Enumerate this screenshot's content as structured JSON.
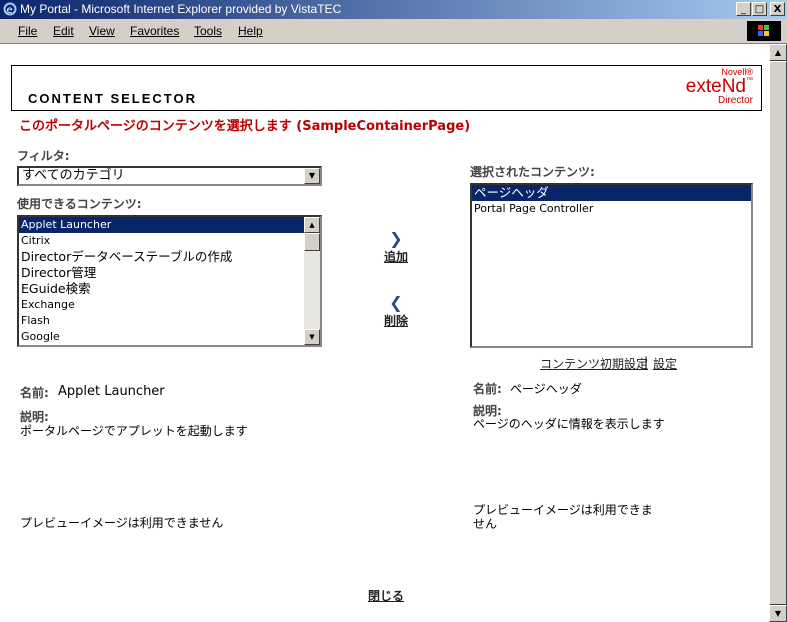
{
  "window": {
    "title": "My Portal - Microsoft Internet Explorer provided by VistaTEC",
    "minimize": "_",
    "maximize": "□",
    "close": "X"
  },
  "menu": [
    "File",
    "Edit",
    "View",
    "Favorites",
    "Tools",
    "Help"
  ],
  "header": {
    "title": "CONTENT SELECTOR",
    "brand_small": "Novell®",
    "brand_main": "exteNd",
    "brand_tm": "™",
    "brand_sub": "Director"
  },
  "page_heading": "このポータルページのコンテンツを選択します (SampleContainerPage)",
  "filter": {
    "label": "フィルタ:",
    "selected": "すべてのカテゴリ"
  },
  "available": {
    "label": "使用できるコンテンツ:",
    "items": [
      "Applet Launcher",
      "Citrix",
      "Directorデータベーステーブルの作成",
      "Director管理",
      "EGuide検索",
      "Exchange",
      "Flash",
      "Google"
    ],
    "selected_index": 0
  },
  "selected_content": {
    "label": "選択されたコンテンツ:",
    "items": [
      "ページヘッダ",
      "Portal Page Controller"
    ],
    "selected_index": 0
  },
  "actions": {
    "add": "追加",
    "remove": "削除"
  },
  "links": {
    "initial_settings": "コンテンツ初期設定",
    "separator": "|",
    "settings": "設定"
  },
  "left_detail": {
    "name_label": "名前:",
    "name_value": "Applet Launcher",
    "desc_label": "説明:",
    "desc_value": "ポータルページでアプレットを起動します",
    "preview": "プレビューイメージは利用できません"
  },
  "right_detail": {
    "name_label": "名前:",
    "name_value": "ページヘッダ",
    "desc_label": "説明:",
    "desc_value": "ページのヘッダに情報を表示します",
    "preview_line1": "プレビューイメージは利用できま",
    "preview_line2": "せん"
  },
  "close_link": "閉じる"
}
